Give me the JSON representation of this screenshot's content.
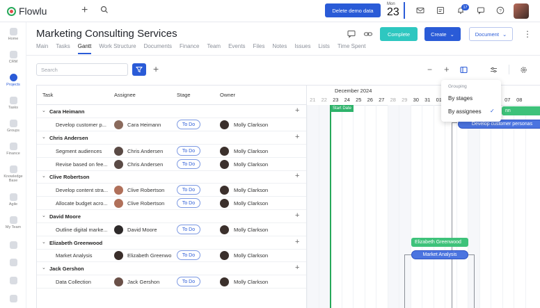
{
  "app": {
    "logo_text": "Flowlu"
  },
  "topbar": {
    "demo_button": "Delete demo data",
    "date_month": "Mon",
    "date_day": "23",
    "notification_count": "17"
  },
  "sidebar": {
    "items": [
      {
        "label": "Home",
        "icon": "home-icon"
      },
      {
        "label": "CRM",
        "icon": "crm-icon"
      },
      {
        "label": "Projects",
        "icon": "projects-icon",
        "active": true
      },
      {
        "label": "Tasks",
        "icon": "tasks-icon"
      },
      {
        "label": "Groups",
        "icon": "groups-icon"
      },
      {
        "label": "Finance",
        "icon": "finance-icon"
      },
      {
        "label": "Knowledge Base",
        "icon": "knowledge-base-icon"
      },
      {
        "label": "Agile",
        "icon": "agile-icon"
      },
      {
        "label": "My Team",
        "icon": "team-icon"
      }
    ]
  },
  "header": {
    "title": "Marketing Consulting Services",
    "complete_label": "Complete",
    "create_label": "Create",
    "document_label": "Document"
  },
  "tabs": [
    "Main",
    "Tasks",
    "Gantt",
    "Work Structure",
    "Documents",
    "Finance",
    "Team",
    "Events",
    "Files",
    "Notes",
    "Issues",
    "Lists",
    "Time Spent"
  ],
  "active_tab": "Gantt",
  "toolbar": {
    "search_placeholder": "Search",
    "zoom_minus": "−",
    "zoom_plus": "+"
  },
  "table": {
    "columns": [
      "Task",
      "Assignee",
      "Stage",
      "Owner"
    ],
    "rows": [
      {
        "type": "group",
        "name": "Cara Heimann"
      },
      {
        "type": "task",
        "name": "Develop customer p...",
        "assignee": "Cara Heimann",
        "stage": "To Do",
        "owner": "Molly Clarkson"
      },
      {
        "type": "group",
        "name": "Chris Andersen"
      },
      {
        "type": "task",
        "name": "Segment audiences",
        "assignee": "Chris Andersen",
        "stage": "To Do",
        "owner": "Molly Clarkson"
      },
      {
        "type": "task",
        "name": "Revise based on fee...",
        "assignee": "Chris Andersen",
        "stage": "To Do",
        "owner": "Molly Clarkson"
      },
      {
        "type": "group",
        "name": "Clive Robertson"
      },
      {
        "type": "task",
        "name": "Develop content stra...",
        "assignee": "Clive Robertson",
        "stage": "To Do",
        "owner": "Molly Clarkson"
      },
      {
        "type": "task",
        "name": "Allocate budget acro...",
        "assignee": "Clive Robertson",
        "stage": "To Do",
        "owner": "Molly Clarkson"
      },
      {
        "type": "group",
        "name": "David Moore"
      },
      {
        "type": "task",
        "name": "Outline digital marke...",
        "assignee": "David Moore",
        "stage": "To Do",
        "owner": "Molly Clarkson"
      },
      {
        "type": "group",
        "name": "Elizabeth Greenwood"
      },
      {
        "type": "task",
        "name": "Market Analysis",
        "assignee": "Elizabeth Greenwo",
        "stage": "To Do",
        "owner": "Molly Clarkson"
      },
      {
        "type": "group",
        "name": "Jack Gershon"
      },
      {
        "type": "task",
        "name": "Data Collection",
        "assignee": "Jack Gershon",
        "stage": "To Do",
        "owner": "Molly Clarkson"
      }
    ]
  },
  "gantt": {
    "month": "December 2024",
    "days": [
      "21",
      "22",
      "23",
      "24",
      "25",
      "26",
      "27",
      "28",
      "29",
      "30",
      "31",
      "01",
      "07",
      "08"
    ],
    "weekend_days": [
      "21",
      "22",
      "28",
      "29"
    ],
    "start_label": "Start Date",
    "bars": [
      {
        "label": "nn",
        "color": "green",
        "row": 0
      },
      {
        "label": "Develop customer personas",
        "color": "blue",
        "row": 1
      },
      {
        "label": "Elizabeth Greenwood",
        "color": "green",
        "row": 10
      },
      {
        "label": "Market Analysis",
        "color": "blue",
        "row": 11
      }
    ]
  },
  "grouping_menu": {
    "title": "Grouping",
    "options": [
      "By stages",
      "By assignees"
    ],
    "selected": "By assignees",
    "check": "✓"
  }
}
